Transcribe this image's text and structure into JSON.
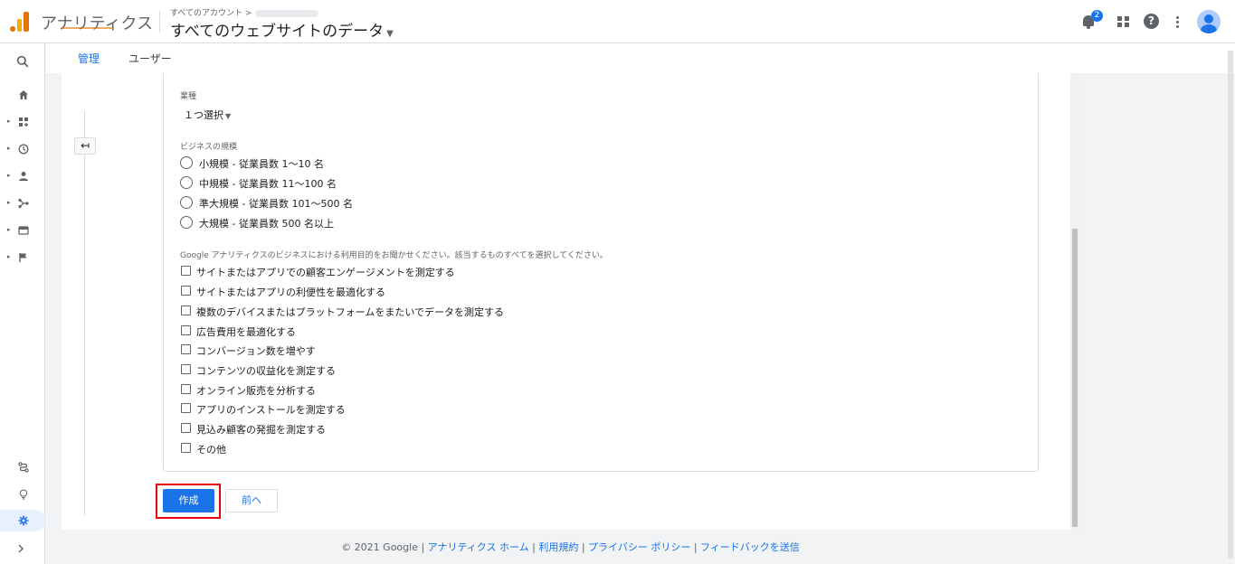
{
  "header": {
    "app_title": "アナリティクス",
    "breadcrumb": "すべてのアカウント >",
    "property": "すべてのウェブサイトのデータ",
    "notification_count": "2",
    "help_glyph": "?"
  },
  "tabs": [
    {
      "label": "管理"
    },
    {
      "label": "ユーザー"
    }
  ],
  "form": {
    "industry_label": "業種",
    "industry_value": "１つ選択",
    "size_label": "ビジネスの規模",
    "size_options": [
      "小規模 - 従業員数 1～10 名",
      "中規模 - 従業員数 11～100 名",
      "準大規模 - 従業員数 101～500 名",
      "大規模 - 従業員数 500 名以上"
    ],
    "purpose_label": "Google アナリティクスのビジネスにおける利用目的をお聞かせください。該当するものすべてを選択してください。",
    "purpose_options": [
      "サイトまたはアプリでの顧客エンゲージメントを測定する",
      "サイトまたはアプリの利便性を最適化する",
      "複数のデバイスまたはプラットフォームをまたいでデータを測定する",
      "広告費用を最適化する",
      "コンバージョン数を増やす",
      "コンテンツの収益化を測定する",
      "オンライン販売を分析する",
      "アプリのインストールを測定する",
      "見込み顧客の発掘を測定する",
      "その他"
    ],
    "create_label": "作成",
    "back_label": "前へ",
    "back_arrow": "↤"
  },
  "footer": {
    "copyright": "© 2021 Google",
    "links": [
      "アナリティクス ホーム",
      "利用規約",
      "プライバシー ポリシー",
      "フィードバックを送信"
    ]
  },
  "colors": {
    "accent": "#1a73e8",
    "highlight_box": "#e8000b",
    "logo_orange": "#e37400"
  }
}
